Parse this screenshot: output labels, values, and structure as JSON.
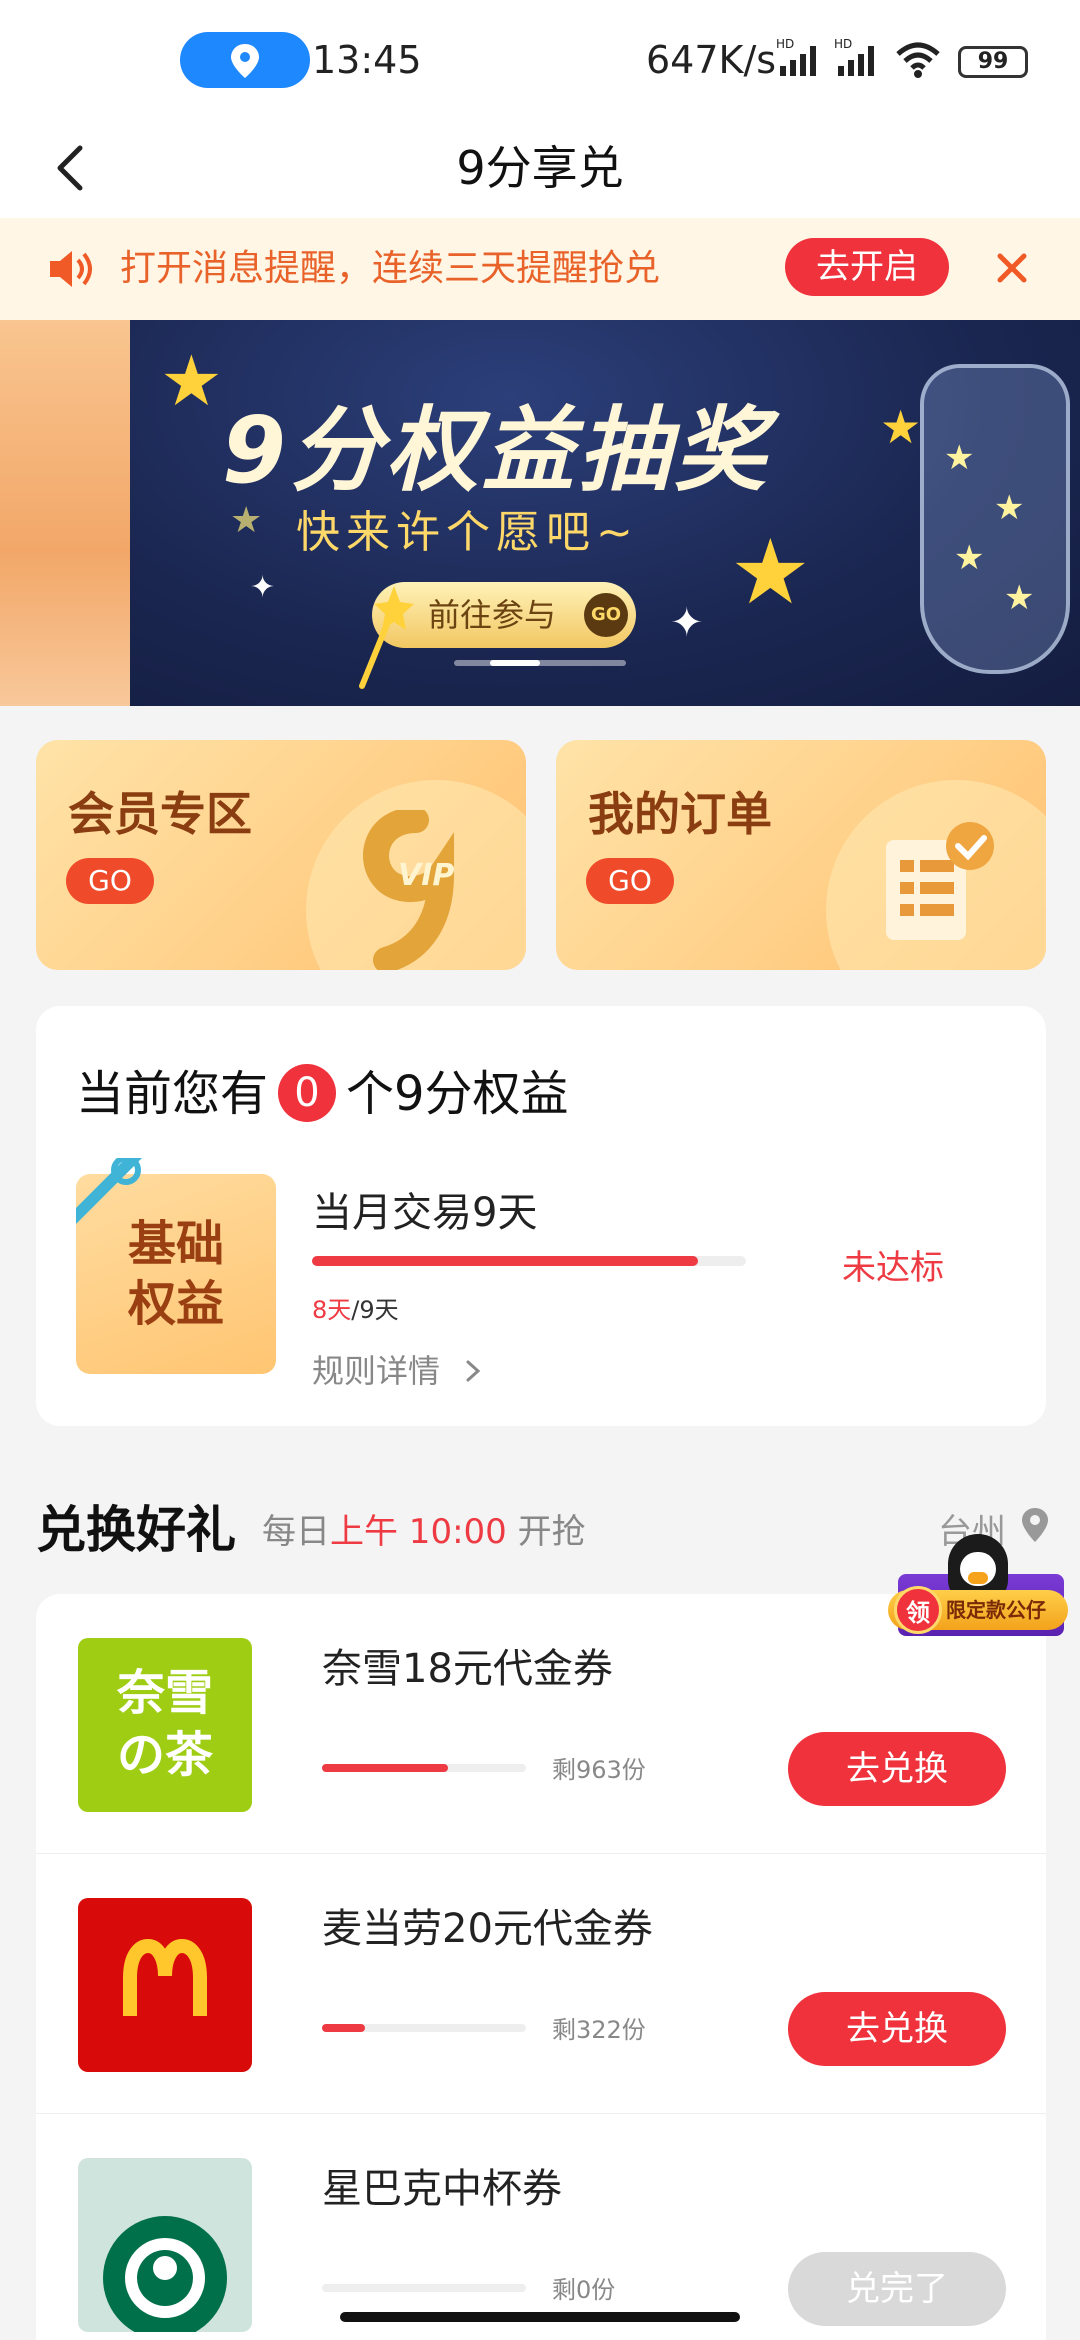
{
  "status_bar": {
    "time": "13:45",
    "net_speed": "647K/s",
    "battery": "99",
    "hd1": "HD",
    "hd2": "HD"
  },
  "nav": {
    "title": "9分享兑"
  },
  "notice": {
    "text": "打开消息提醒，连续三天提醒抢兑",
    "button": "去开启"
  },
  "banner": {
    "title": "9分权益抽奖",
    "subtitle": "快来许个愿吧~",
    "cta": "前往参与",
    "cta_go": "GO"
  },
  "features": [
    {
      "title": "会员专区",
      "go": "GO",
      "icon": "vip9-icon"
    },
    {
      "title": "我的订单",
      "go": "GO",
      "icon": "order-list-icon"
    }
  ],
  "benefit": {
    "prefix": "当前您有",
    "count": "0",
    "suffix": "个9分权益",
    "basic_line1": "基础",
    "basic_line2": "权益",
    "task_title": "当月交易9天",
    "progress": 0.889,
    "done_days": "8天",
    "total_days": "/9天",
    "rule_link": "规则详情",
    "status": "未达标"
  },
  "section": {
    "title": "兑换好礼",
    "sub_prefix": "每日",
    "sub_time": "上午 10:00",
    "sub_suffix": "开抢",
    "city": "台州",
    "float_ling": "领",
    "float_text": "限定款公仔"
  },
  "products": [
    {
      "name": "奈雪18元代金券",
      "remaining": "剩963份",
      "button": "去兑换",
      "progress": 0.62,
      "logo_text_1": "奈雪",
      "logo_text_2": "の茶"
    },
    {
      "name": "麦当劳20元代金券",
      "remaining": "剩322份",
      "button": "去兑换",
      "progress": 0.21
    },
    {
      "name": "星巴克中杯券",
      "remaining": "剩0份",
      "button": "兑完了",
      "progress": 0.0
    }
  ],
  "colors": {
    "accent_red": "#f0323c",
    "notice_orange": "#e8622a",
    "banner_navy": "#1c2a57"
  }
}
